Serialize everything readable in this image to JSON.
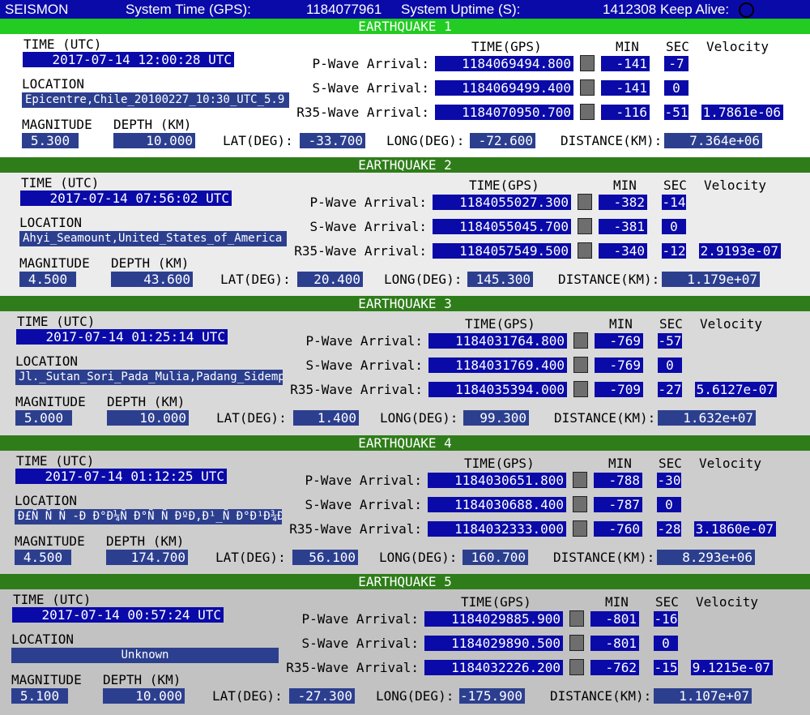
{
  "topbar": {
    "app": "SEISMON",
    "time_label": "System Time (GPS):",
    "time_value": "1184077961",
    "uptime_label": "System Uptime (S):",
    "uptime_value": "1412308",
    "keepalive_label": "Keep Alive:"
  },
  "labels": {
    "time_utc": "TIME (UTC)",
    "location": "LOCATION",
    "magnitude": "MAGNITUDE",
    "depth": "DEPTH (KM)",
    "time_gps": "TIME(GPS)",
    "min": "MIN",
    "sec": "SEC",
    "velocity": "Velocity",
    "p_wave": "P-Wave Arrival:",
    "s_wave": "S-Wave Arrival:",
    "r35_wave": "R35-Wave Arrival:",
    "lat": "LAT(DEG):",
    "long": "LONG(DEG):",
    "distance": "DISTANCE(KM):"
  },
  "colors": {
    "band_bright": "#22cc22",
    "band_dark": "#2f7d1a",
    "value_box": "#0a0aa8",
    "value_box_light": "#2c3f8f",
    "bg1": "#ffffff",
    "bg2": "#ececec",
    "bg3": "#d9d9d9",
    "bg4": "#cdcdcd",
    "bg5": "#c2c2c2"
  },
  "earthquakes": [
    {
      "title": "EARTHQUAKE 1",
      "time_utc": "2017-07-14 12:00:28 UTC",
      "location": "Epicentre,Chile_20100227_10:30_UTC_5.9",
      "magnitude": "5.300",
      "depth": "10.000",
      "p_time": "1184069494.800",
      "p_min": "-141",
      "p_sec": "-7",
      "s_time": "1184069499.400",
      "s_min": "-141",
      "s_sec": "0",
      "r_time": "1184070950.700",
      "r_min": "-116",
      "r_sec": "-51",
      "velocity": "1.7861e-06",
      "lat": "-33.700",
      "long": "-72.600",
      "distance": "7.364e+06"
    },
    {
      "title": "EARTHQUAKE 2",
      "time_utc": "2017-07-14 07:56:02 UTC",
      "location": "Ahyi_Seamount,United_States_of_America",
      "magnitude": "4.500",
      "depth": "43.600",
      "p_time": "1184055027.300",
      "p_min": "-382",
      "p_sec": "-14",
      "s_time": "1184055045.700",
      "s_min": "-381",
      "s_sec": "0",
      "r_time": "1184057549.500",
      "r_min": "-340",
      "r_sec": "-12",
      "velocity": "2.9193e-07",
      "lat": "20.400",
      "long": "145.300",
      "distance": "1.179e+07"
    },
    {
      "title": "EARTHQUAKE 3",
      "time_utc": "2017-07-14 01:25:14 UTC",
      "location": "Jl._Sutan_Sori_Pada_Mulia,Padang_Sidemp",
      "magnitude": "5.000",
      "depth": "10.000",
      "p_time": "1184031764.800",
      "p_min": "-769",
      "p_sec": "-57",
      "s_time": "1184031769.400",
      "s_min": "-769",
      "s_sec": "0",
      "r_time": "1184035394.000",
      "r_min": "-709",
      "r_sec": "-27",
      "velocity": "5.6127e-07",
      "lat": "1.400",
      "long": "99.300",
      "distance": "1.632e+07"
    },
    {
      "title": "EARTHQUAKE 4",
      "time_utc": "2017-07-14 01:12:25 UTC",
      "location": "Ð£Ñ Ñ Ñ -Ð Ð°Ð¼Ñ Ð°Ñ Ñ ÐºÐ,Ð¹_Ñ Ð°Ð¹Ð¾Ð",
      "magnitude": "4.500",
      "depth": "174.700",
      "p_time": "1184030651.800",
      "p_min": "-788",
      "p_sec": "-30",
      "s_time": "1184030688.400",
      "s_min": "-787",
      "s_sec": "0",
      "r_time": "1184032333.000",
      "r_min": "-760",
      "r_sec": "-28",
      "velocity": "3.1860e-07",
      "lat": "56.100",
      "long": "160.700",
      "distance": "8.293e+06"
    },
    {
      "title": "EARTHQUAKE 5",
      "time_utc": "2017-07-14 00:57:24 UTC",
      "location": "Unknown",
      "magnitude": "5.100",
      "depth": "10.000",
      "p_time": "1184029885.900",
      "p_min": "-801",
      "p_sec": "-16",
      "s_time": "1184029890.500",
      "s_min": "-801",
      "s_sec": "0",
      "r_time": "1184032226.200",
      "r_min": "-762",
      "r_sec": "-15",
      "velocity": "9.1215e-07",
      "lat": "-27.300",
      "long": "-175.900",
      "distance": "1.107e+07"
    }
  ]
}
